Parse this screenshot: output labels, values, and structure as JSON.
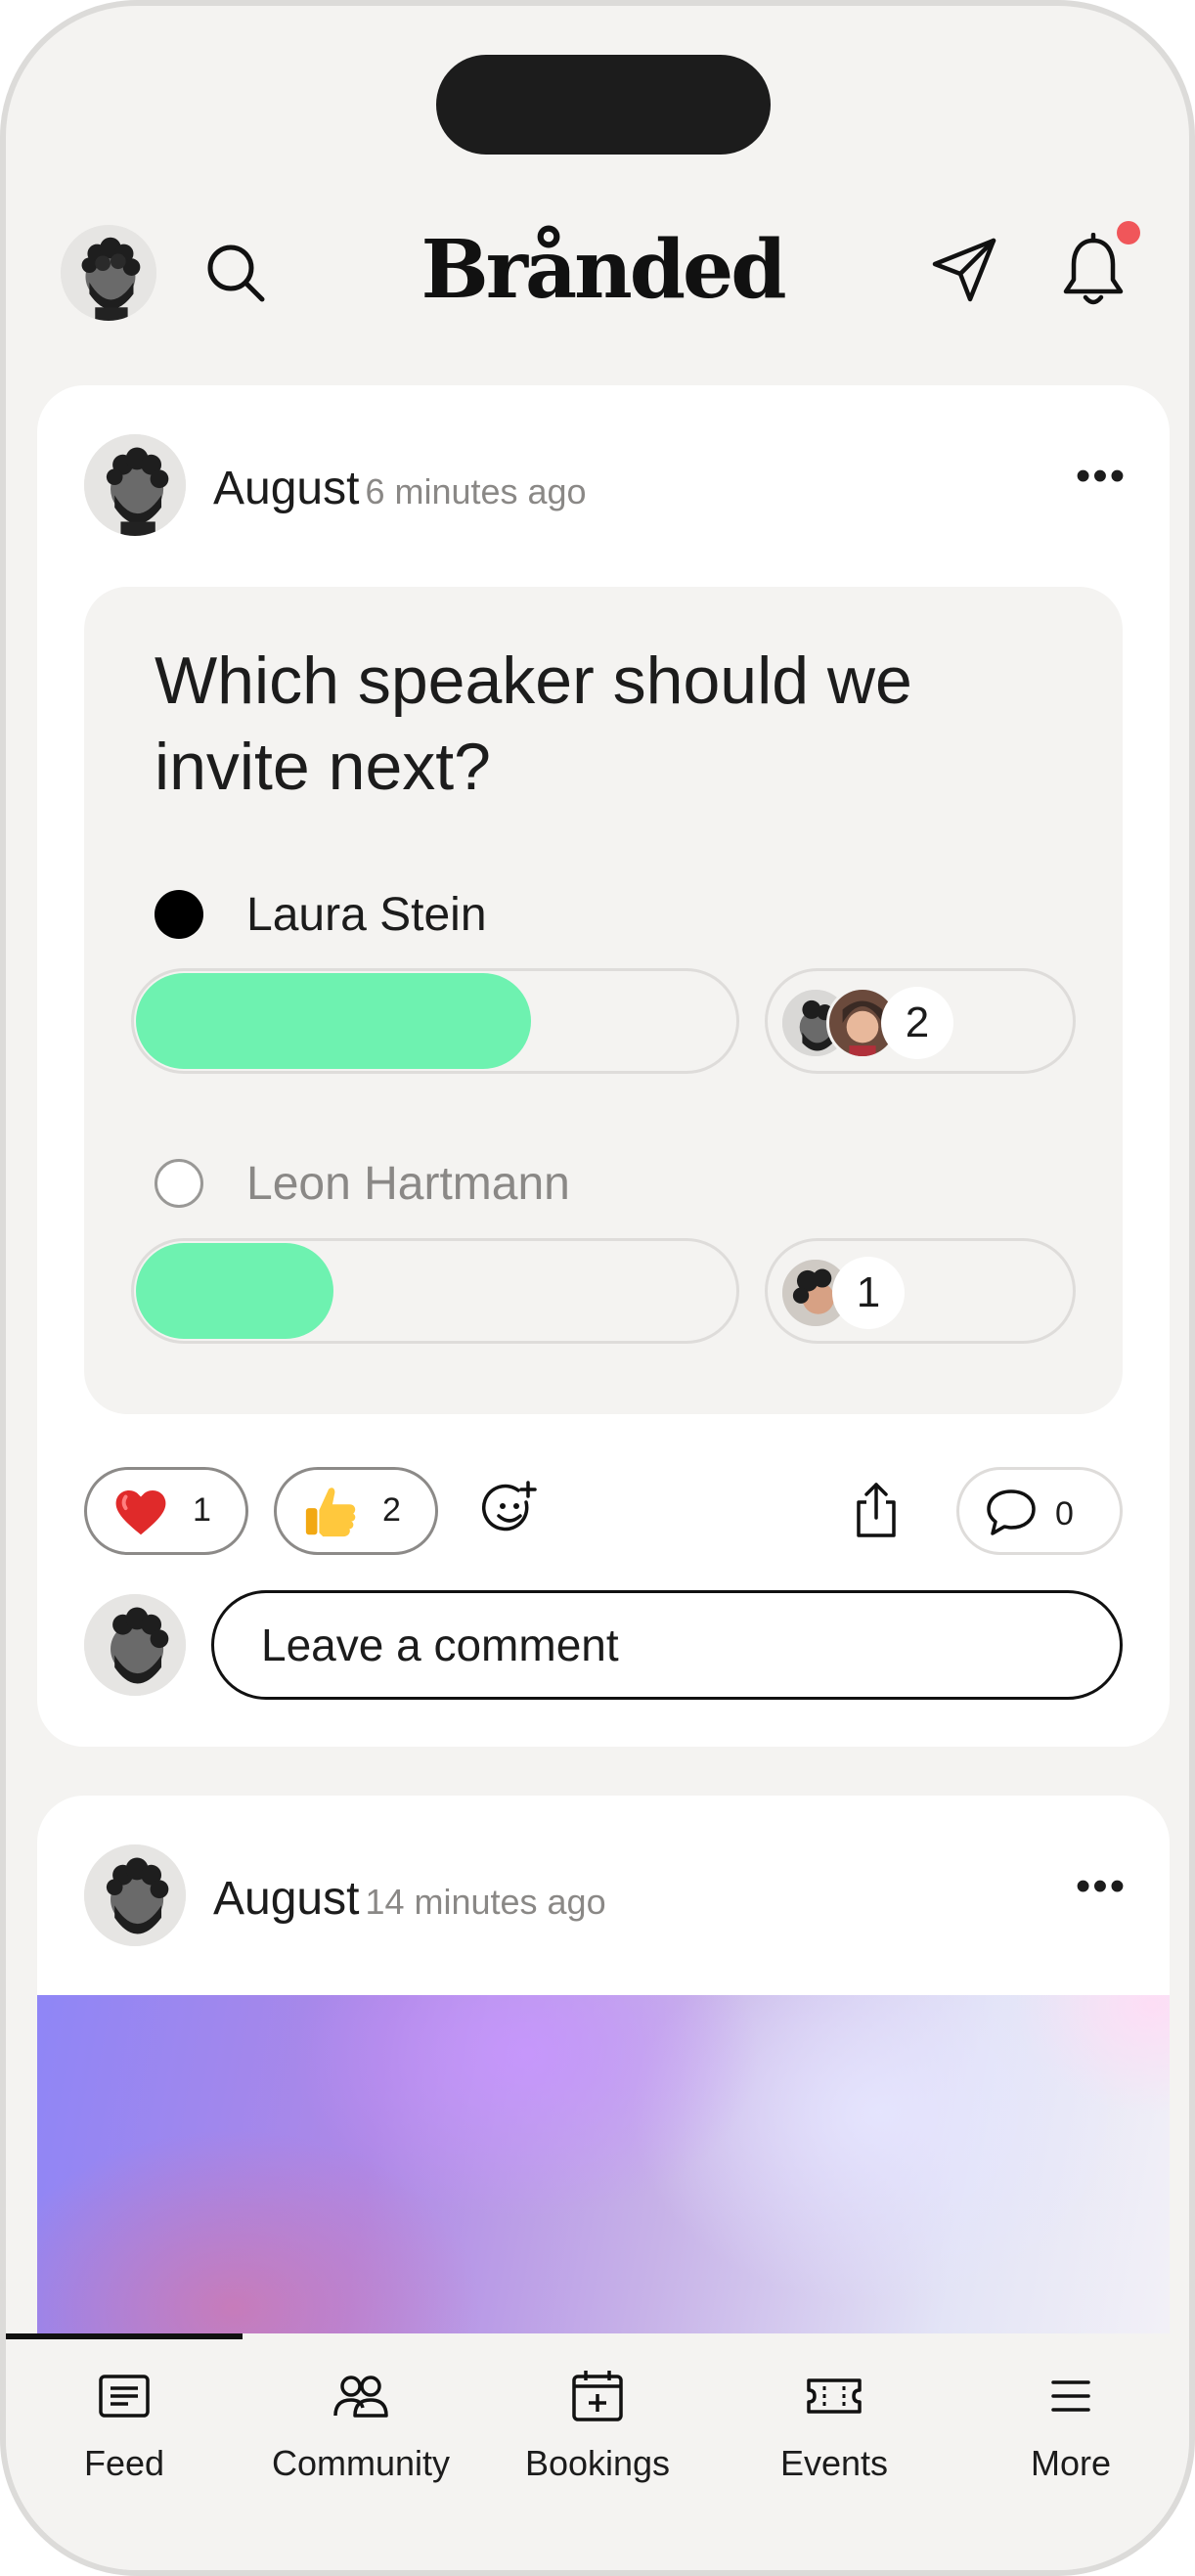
{
  "header": {
    "logo": "Brånded",
    "icons": [
      "user-avatar",
      "search-icon",
      "send-icon",
      "bell-icon"
    ],
    "notification_dot_color": "#f0565a"
  },
  "posts": [
    {
      "author": "August",
      "time": "6 minutes ago",
      "poll": {
        "question": "Which speaker should we invite next?",
        "options": [
          {
            "label": "Laura Stein",
            "selected": true,
            "votes": "2",
            "fill_fraction": 0.66
          },
          {
            "label": "Leon Hartmann",
            "selected": false,
            "votes": "1",
            "fill_fraction": 0.33
          }
        ],
        "bar_color": "#6ef2b0"
      },
      "reactions": [
        {
          "emoji": "heart",
          "count": "1"
        },
        {
          "emoji": "thumbs-up",
          "count": "2"
        }
      ],
      "comment_count": "0",
      "comment_placeholder": "Leave a comment"
    },
    {
      "author": "August",
      "time": "14 minutes ago"
    }
  ],
  "tabbar": {
    "active": "Feed",
    "tabs": [
      {
        "label": "Feed",
        "icon": "feed-icon"
      },
      {
        "label": "Community",
        "icon": "community-icon"
      },
      {
        "label": "Bookings",
        "icon": "bookings-icon"
      },
      {
        "label": "Events",
        "icon": "events-icon"
      },
      {
        "label": "More",
        "icon": "menu-icon"
      }
    ]
  }
}
